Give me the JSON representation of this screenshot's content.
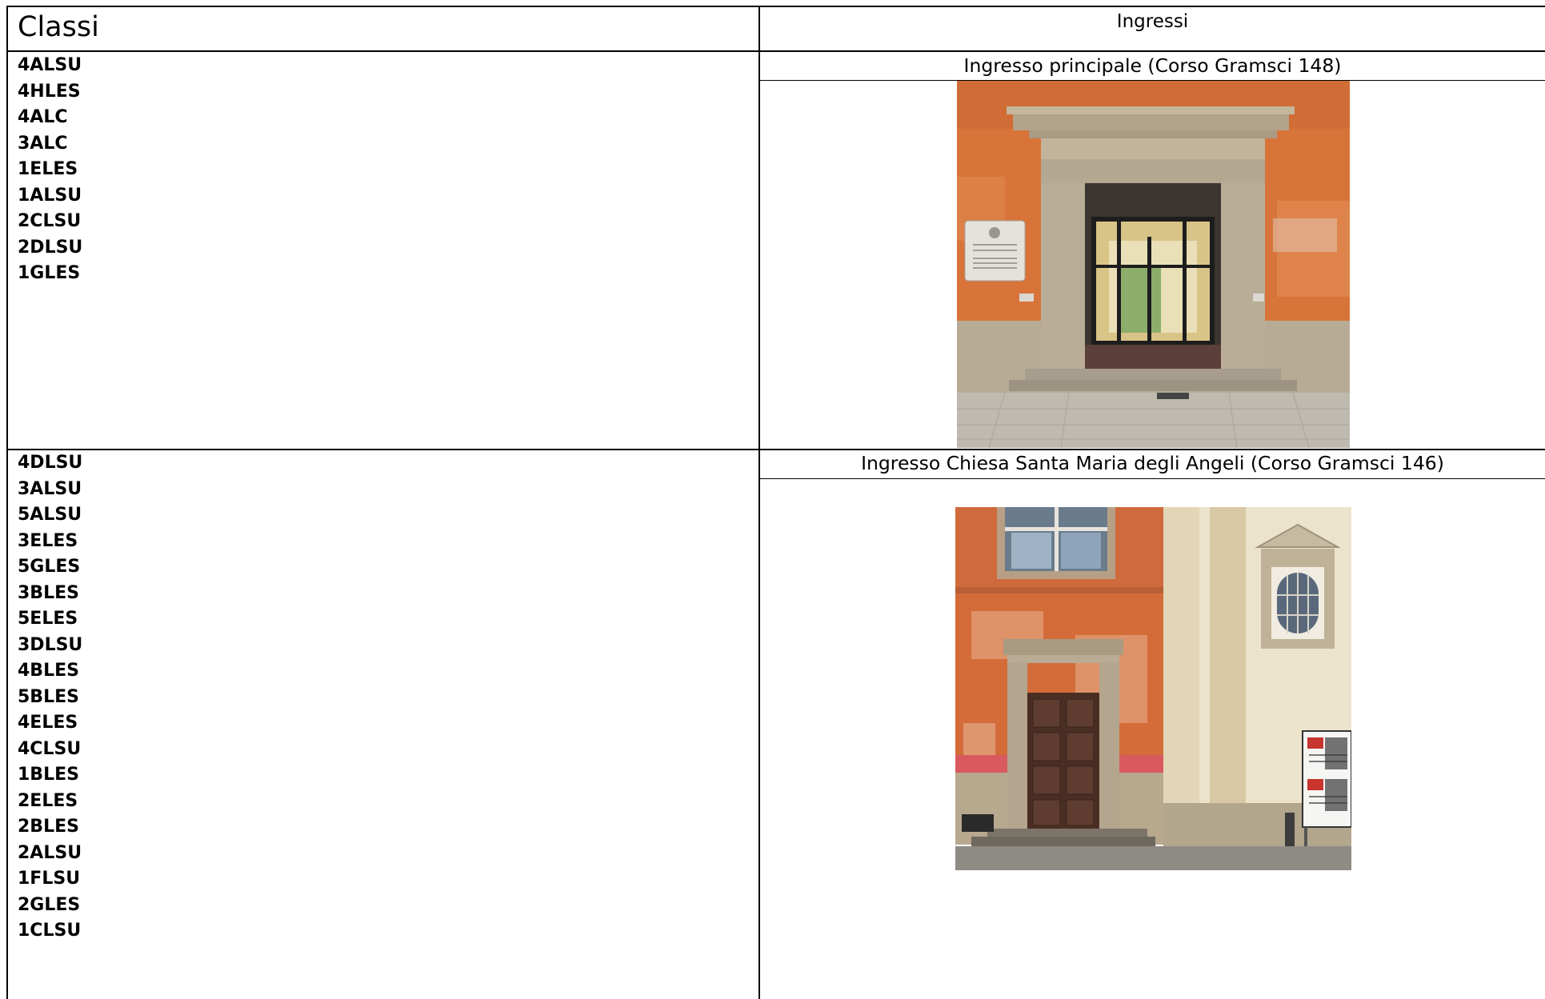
{
  "header": {
    "classi_label": "Classi",
    "ingressi_label": "Ingressi"
  },
  "entrances": [
    {
      "title": "Ingresso principale (Corso Gramsci 148)",
      "classes": [
        "4ALSU",
        "4HLES",
        "4ALC",
        "3ALC",
        "1ELES",
        "1ALSU",
        "2CLSU",
        "2DLSU",
        "1GLES"
      ]
    },
    {
      "title": "Ingresso Chiesa Santa Maria degli Angeli (Corso Gramsci 146)",
      "classes": [
        "4DLSU",
        "3ALSU",
        "5ALSU",
        "3ELES",
        "5GLES",
        "3BLES",
        "5ELES",
        "3DLSU",
        "4BLES",
        "5BLES",
        "4ELES",
        "4CLSU",
        "1BLES",
        "2ELES",
        "2BLES",
        "2ALSU",
        "1FLSU",
        "2GLES",
        "1CLSU"
      ]
    }
  ],
  "colors": {
    "wall_orange": "#d8743a",
    "stone": "#b9ad97",
    "church_wall": "#ece3cc",
    "door_wood": "#4a2e24"
  }
}
